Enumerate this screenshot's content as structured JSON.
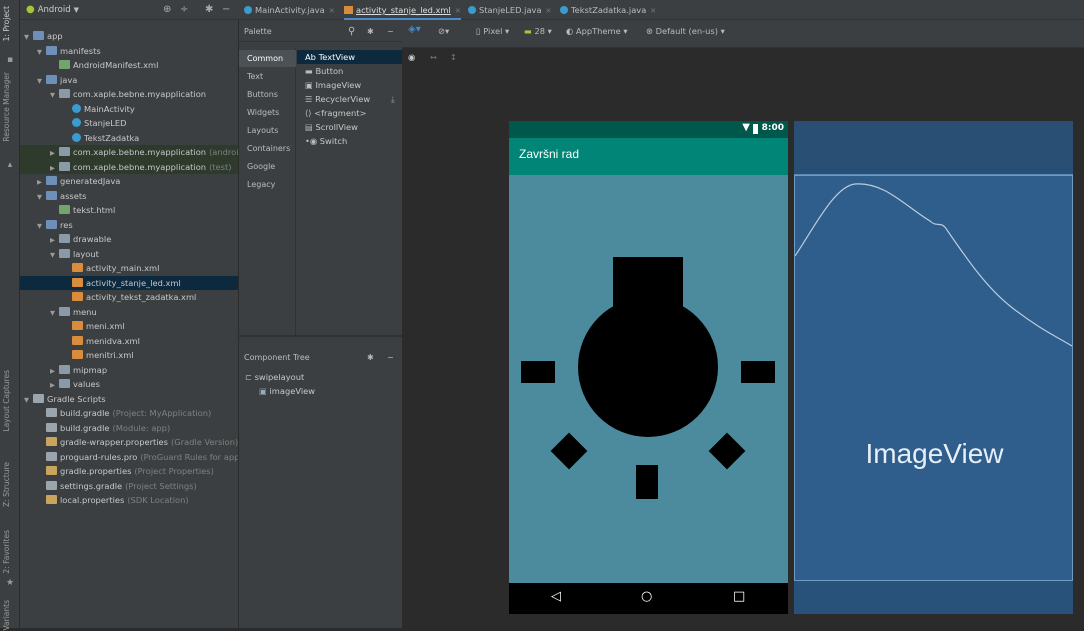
{
  "toolstrip": {
    "tabs": [
      "1: Project",
      "Resource Manager",
      "Layout Captures",
      "Z: Structure",
      "2: Favorites",
      "Variants"
    ]
  },
  "project": {
    "view_label": "Android",
    "tree": [
      {
        "label": "app",
        "suffix": ""
      },
      {
        "label": "manifests",
        "suffix": ""
      },
      {
        "label": "AndroidManifest.xml",
        "suffix": ""
      },
      {
        "label": "java",
        "suffix": ""
      },
      {
        "label": "com.xaple.bebne.myapplication",
        "suffix": ""
      },
      {
        "label": "MainActivity",
        "suffix": ""
      },
      {
        "label": "StanjeLED",
        "suffix": ""
      },
      {
        "label": "TekstZadatka",
        "suffix": ""
      },
      {
        "label": "com.xaple.bebne.myapplication",
        "suffix": "(androidT"
      },
      {
        "label": "com.xaple.bebne.myapplication",
        "suffix": "(test)"
      },
      {
        "label": "generatedJava",
        "suffix": ""
      },
      {
        "label": "assets",
        "suffix": ""
      },
      {
        "label": "tekst.html",
        "suffix": ""
      },
      {
        "label": "res",
        "suffix": ""
      },
      {
        "label": "drawable",
        "suffix": ""
      },
      {
        "label": "layout",
        "suffix": ""
      },
      {
        "label": "activity_main.xml",
        "suffix": ""
      },
      {
        "label": "activity_stanje_led.xml",
        "suffix": ""
      },
      {
        "label": "activity_tekst_zadatka.xml",
        "suffix": ""
      },
      {
        "label": "menu",
        "suffix": ""
      },
      {
        "label": "meni.xml",
        "suffix": ""
      },
      {
        "label": "menidva.xml",
        "suffix": ""
      },
      {
        "label": "menitri.xml",
        "suffix": ""
      },
      {
        "label": "mipmap",
        "suffix": ""
      },
      {
        "label": "values",
        "suffix": ""
      },
      {
        "label": "Gradle Scripts",
        "suffix": ""
      },
      {
        "label": "build.gradle",
        "suffix": "(Project: MyApplication)"
      },
      {
        "label": "build.gradle",
        "suffix": "(Module: app)"
      },
      {
        "label": "gradle-wrapper.properties",
        "suffix": "(Gradle Version)"
      },
      {
        "label": "proguard-rules.pro",
        "suffix": "(ProGuard Rules for app)"
      },
      {
        "label": "gradle.properties",
        "suffix": "(Project Properties)"
      },
      {
        "label": "settings.gradle",
        "suffix": "(Project Settings)"
      },
      {
        "label": "local.properties",
        "suffix": "(SDK Location)"
      }
    ]
  },
  "tabs": [
    {
      "label": "MainActivity.java",
      "kind": "java"
    },
    {
      "label": "activity_stanje_led.xml",
      "kind": "xml"
    },
    {
      "label": "StanjeLED.java",
      "kind": "java"
    },
    {
      "label": "TekstZadatka.java",
      "kind": "java"
    }
  ],
  "palette": {
    "title": "Palette",
    "categories": [
      "Common",
      "Text",
      "Buttons",
      "Widgets",
      "Layouts",
      "Containers",
      "Google",
      "Legacy"
    ],
    "items": [
      "Ab TextView",
      "Button",
      "ImageView",
      "RecyclerView",
      "<fragment>",
      "ScrollView",
      "Switch"
    ]
  },
  "component_tree": {
    "title": "Component Tree",
    "root": "swipelayout",
    "child": "imageView"
  },
  "design_toolbar": {
    "device": "Pixel",
    "api": "28",
    "theme": "AppTheme",
    "locale": "Default (en-us)"
  },
  "phone": {
    "time": "8:00",
    "app_title": "Završni rad"
  },
  "blueprint": {
    "label": "ImageView"
  },
  "colors": {
    "accent": "#4a88c7",
    "app_bar": "#008577",
    "status_bar": "#00574b",
    "content_bg": "#4b8b9d",
    "blueprint_bg": "#2f5d8c"
  }
}
